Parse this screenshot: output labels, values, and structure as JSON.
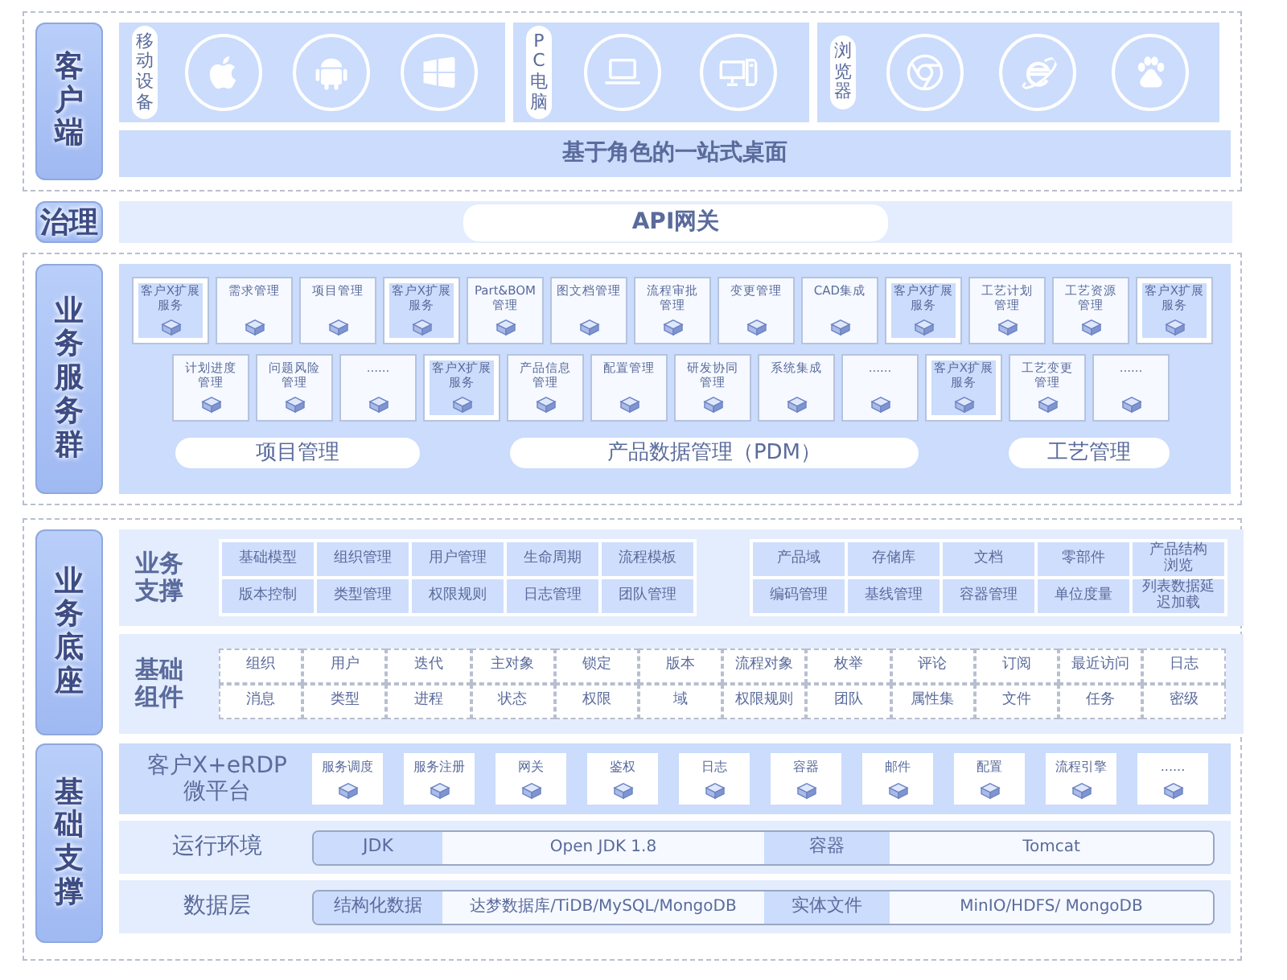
{
  "client": {
    "label": "客户端",
    "groups": [
      {
        "label": "移动设备",
        "kind": "mobile"
      },
      {
        "label": "PC电脑",
        "kind": "pc"
      },
      {
        "label": "浏览器",
        "kind": "browser"
      }
    ],
    "desktop": "基于角色的一站式桌面"
  },
  "governance": {
    "label": "治理",
    "gateway": "API网关"
  },
  "business_services": {
    "label": "业务服务群",
    "row_1": [
      {
        "lines": [
          "客户X扩展",
          "服务"
        ],
        "kind": "extension"
      },
      {
        "lines": [
          "需求管理"
        ],
        "kind": "module"
      },
      {
        "lines": [
          "项目管理"
        ],
        "kind": "module"
      },
      {
        "lines": [
          "客户X扩展",
          "服务"
        ],
        "kind": "extension"
      },
      {
        "lines": [
          "Part&BOM",
          "管理"
        ],
        "kind": "module"
      },
      {
        "lines": [
          "图文档管理"
        ],
        "kind": "module"
      },
      {
        "lines": [
          "流程审批",
          "管理"
        ],
        "kind": "module"
      },
      {
        "lines": [
          "变更管理"
        ],
        "kind": "module"
      },
      {
        "lines": [
          "CAD集成"
        ],
        "kind": "module"
      },
      {
        "lines": [
          "客户X扩展",
          "服务"
        ],
        "kind": "extension"
      },
      {
        "lines": [
          "工艺计划",
          "管理"
        ],
        "kind": "module"
      },
      {
        "lines": [
          "工艺资源",
          "管理"
        ],
        "kind": "module"
      },
      {
        "lines": [
          "客户X扩展",
          "服务"
        ],
        "kind": "extension"
      }
    ],
    "row_2": [
      {
        "lines": [
          "计划进度",
          "管理"
        ],
        "kind": "module"
      },
      {
        "lines": [
          "问题风险",
          "管理"
        ],
        "kind": "module"
      },
      {
        "lines": [
          "......"
        ],
        "kind": "module"
      },
      {
        "lines": [
          "客户X扩展",
          "服务"
        ],
        "kind": "extension"
      },
      {
        "lines": [
          "产品信息",
          "管理"
        ],
        "kind": "module"
      },
      {
        "lines": [
          "配置管理"
        ],
        "kind": "module"
      },
      {
        "lines": [
          "研发协同",
          "管理"
        ],
        "kind": "module"
      },
      {
        "lines": [
          "系统集成"
        ],
        "kind": "module"
      },
      {
        "lines": [
          "......"
        ],
        "kind": "module"
      },
      {
        "lines": [
          "客户X扩展",
          "服务"
        ],
        "kind": "extension"
      },
      {
        "lines": [
          "工艺变更",
          "管理"
        ],
        "kind": "module"
      },
      {
        "lines": [
          "......"
        ],
        "kind": "module"
      }
    ],
    "domains": [
      "项目管理",
      "产品数据管理（PDM）",
      "工艺管理"
    ]
  },
  "business_foundation": {
    "label": "业务底座",
    "support": {
      "label": "业务支撑",
      "left_grid": [
        [
          [
            "基础模型"
          ],
          [
            "组织管理"
          ],
          [
            "用户管理"
          ],
          [
            "生命周期"
          ],
          [
            "流程模板"
          ]
        ],
        [
          [
            "版本控制"
          ],
          [
            "类型管理"
          ],
          [
            "权限规则"
          ],
          [
            "日志管理"
          ],
          [
            "团队管理"
          ]
        ]
      ],
      "right_grid": [
        [
          [
            "产品域"
          ],
          [
            "存储库"
          ],
          [
            "文档"
          ],
          [
            "零部件"
          ],
          [
            "产品结构",
            "浏览"
          ]
        ],
        [
          [
            "编码管理"
          ],
          [
            "基线管理"
          ],
          [
            "容器管理"
          ],
          [
            "单位度量"
          ],
          [
            "列表数据延",
            "迟加载"
          ]
        ]
      ]
    },
    "components": {
      "label": "基础组件",
      "grid": [
        [
          "组织",
          "用户",
          "迭代",
          "主对象",
          "锁定",
          "版本",
          "流程对象",
          "枚举",
          "评论",
          "订阅",
          "最近访问",
          "日志"
        ],
        [
          "消息",
          "类型",
          "进程",
          "状态",
          "权限",
          "域",
          "权限规则",
          "团队",
          "属性集",
          "文件",
          "任务",
          "密级"
        ]
      ]
    }
  },
  "base_support": {
    "label": "基础支撑",
    "micro_platform": {
      "label": [
        "客户X+eRDP",
        "微平台"
      ],
      "items": [
        "服务调度",
        "服务注册",
        "网关",
        "鉴权",
        "日志",
        "容器",
        "邮件",
        "配置",
        "流程引擎",
        "......"
      ]
    },
    "runtime": {
      "label": "运行环境",
      "cells": [
        {
          "text": "JDK",
          "kind": "key"
        },
        {
          "text": "Open JDK 1.8",
          "kind": "value"
        },
        {
          "text": "容器",
          "kind": "key"
        },
        {
          "text": "Tomcat",
          "kind": "value"
        }
      ]
    },
    "data_layer": {
      "label": "数据层",
      "cells": [
        {
          "text": "结构化数据",
          "kind": "key"
        },
        {
          "text": "达梦数据库/TiDB/MySQL/MongoDB",
          "kind": "value"
        },
        {
          "text": "实体文件",
          "kind": "key"
        },
        {
          "text": "MinIO/HDFS/ MongoDB",
          "kind": "value"
        }
      ]
    }
  }
}
